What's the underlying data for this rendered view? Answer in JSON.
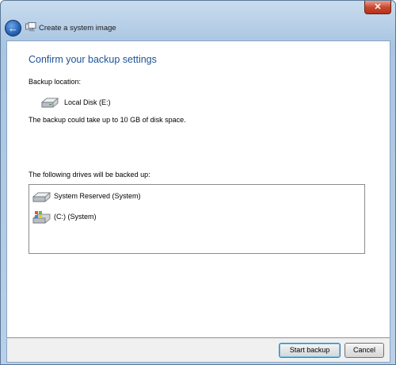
{
  "window": {
    "title": "Create a system image",
    "back_glyph": "←",
    "close_glyph": "✕"
  },
  "main": {
    "heading": "Confirm your backup settings",
    "backup_location_label": "Backup location:",
    "backup_location_value": "Local Disk (E:)",
    "space_text": "The backup could take up to 10 GB of disk space.",
    "drives_label": "The following drives will be backed up:",
    "drives": [
      {
        "label": "System Reserved (System)",
        "icon": "hard-drive-icon"
      },
      {
        "label": "(C:) (System)",
        "icon": "windows-drive-icon"
      }
    ]
  },
  "footer": {
    "start_label": "Start backup",
    "cancel_label": "Cancel"
  },
  "colors": {
    "heading": "#1e5296",
    "close": "#c9492f",
    "frame": "#b9d0e8"
  }
}
